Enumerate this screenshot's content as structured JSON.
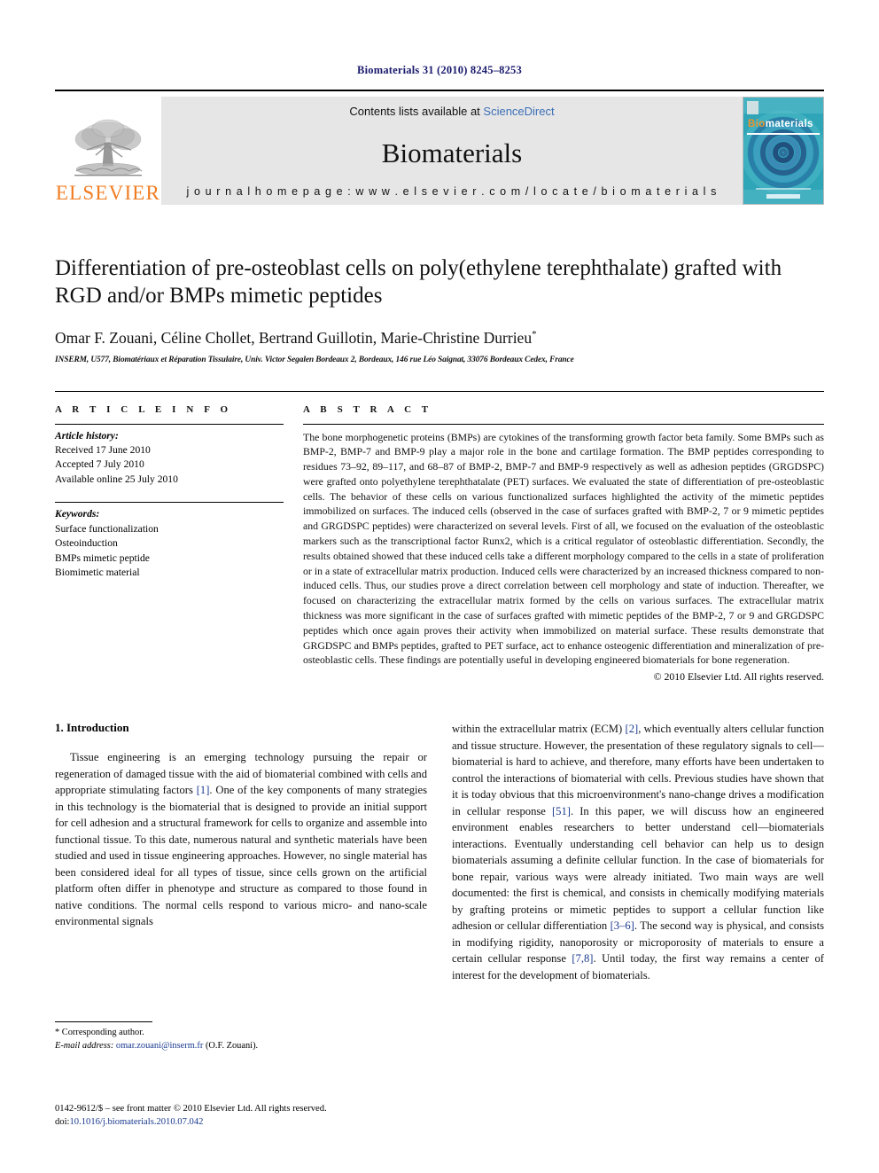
{
  "running_head": "Biomaterials 31 (2010) 8245–8253",
  "header": {
    "publisher_name": "ELSEVIER",
    "contents_prefix": "Contents lists available at ",
    "contents_link": "ScienceDirect",
    "journal_name": "Biomaterials",
    "homepage": "j o u r n a l   h o m e p a g e :   w w w . e l s e v i e r . c o m / l o c a t e / b i o m a t e r i a l s",
    "cover": {
      "title_bio": "Bio",
      "title_materials": "materials",
      "accent_color": "#f0922a",
      "background_color": "#2fa5b8"
    }
  },
  "article": {
    "title": "Differentiation of pre-osteoblast cells on poly(ethylene terephthalate) grafted with RGD and/or BMPs mimetic peptides",
    "authors": "Omar F. Zouani, Céline Chollet, Bertrand Guillotin, Marie-Christine Durrieu",
    "author_mark": "*",
    "affiliation": "INSERM, U577, Biomatériaux et Réparation Tissulaire, Univ. Victor Segalen Bordeaux 2, Bordeaux, 146 rue Léo Saignat, 33076 Bordeaux Cedex, France"
  },
  "article_info": {
    "heading": "A R T I C L E   I N F O",
    "history_label": "Article history:",
    "history": [
      "Received 17 June 2010",
      "Accepted 7 July 2010",
      "Available online 25 July 2010"
    ],
    "keywords_label": "Keywords:",
    "keywords": [
      "Surface functionalization",
      "Osteoinduction",
      "BMPs mimetic peptide",
      "Biomimetic material"
    ]
  },
  "abstract": {
    "heading": "A B S T R A C T",
    "text": "The bone morphogenetic proteins (BMPs) are cytokines of the transforming growth factor beta family. Some BMPs such as BMP-2, BMP-7 and BMP-9 play a major role in the bone and cartilage formation. The BMP peptides corresponding to residues 73–92, 89–117, and 68–87 of BMP-2, BMP-7 and BMP-9 respectively as well as adhesion peptides (GRGDSPC) were grafted onto polyethylene terephthatalate (PET) surfaces. We evaluated the state of differentiation of pre-osteoblastic cells. The behavior of these cells on various functionalized surfaces highlighted the activity of the mimetic peptides immobilized on surfaces. The induced cells (observed in the case of surfaces grafted with BMP-2, 7 or 9 mimetic peptides and GRGDSPC peptides) were characterized on several levels. First of all, we focused on the evaluation of the osteoblastic markers such as the transcriptional factor Runx2, which is a critical regulator of osteoblastic differentiation. Secondly, the results obtained showed that these induced cells take a different morphology compared to the cells in a state of proliferation or in a state of extracellular matrix production. Induced cells were characterized by an increased thickness compared to non-induced cells. Thus, our studies prove a direct correlation between cell morphology and state of induction. Thereafter, we focused on characterizing the extracellular matrix formed by the cells on various surfaces. The extracellular matrix thickness was more significant in the case of surfaces grafted with mimetic peptides of the BMP-2, 7 or 9 and GRGDSPC peptides which once again proves their activity when immobilized on material surface. These results demonstrate that GRGDSPC and BMPs peptides, grafted to PET surface, act to enhance osteogenic differentiation and mineralization of pre-osteoblastic cells. These findings are potentially useful in developing engineered biomaterials for bone regeneration.",
    "copyright": "© 2010 Elsevier Ltd. All rights reserved."
  },
  "introduction": {
    "heading": "1. Introduction",
    "left_column_html": "Tissue engineering is an emerging technology pursuing the repair or regeneration of damaged tissue with the aid of biomaterial combined with cells and appropriate stimulating factors <span class=\"ref\">[1]</span>. One of the key components of many strategies in this technology is the biomaterial that is designed to provide an initial support for cell adhesion and a structural framework for cells to organize and assemble into functional tissue. To this date, numerous natural and synthetic materials have been studied and used in tissue engineering approaches. However, no single material has been considered ideal for all types of tissue, since cells grown on the artificial platform often differ in phenotype and structure as compared to those found in native conditions. The normal cells respond to various micro- and nano-scale environmental signals",
    "right_column_html": "within the extracellular matrix (ECM) <span class=\"ref\">[2]</span>, which eventually alters cellular function and tissue structure. However, the presentation of these regulatory signals to cell—biomaterial is hard to achieve, and therefore, many efforts have been undertaken to control the interactions of biomaterial with cells. Previous studies have shown that it is today obvious that this microenvironment's nano-change drives a modification in cellular response <span class=\"ref\">[51]</span>. In this paper, we will discuss how an engineered environment enables researchers to better understand cell—biomaterials interactions. Eventually understanding cell behavior can help us to design biomaterials assuming a definite cellular function. In the case of biomaterials for bone repair, various ways were already initiated. Two main ways are well documented: the first is chemical, and consists in chemically modifying materials by grafting proteins or mimetic peptides to support a cellular function like adhesion or cellular differentiation <span class=\"ref\">[3–6]</span>. The second way is physical, and consists in modifying rigidity, nanoporosity or microporosity of materials to ensure a certain cellular response <span class=\"ref\">[7,8]</span>. Until today, the first way remains a center of interest for the development of biomaterials."
  },
  "footnote": {
    "corresponding": "* Corresponding author.",
    "email_label": "E-mail address:",
    "email": "omar.zouani@inserm.fr",
    "email_owner": "(O.F. Zouani)."
  },
  "footer": {
    "issn_line": "0142-9612/$ – see front matter © 2010 Elsevier Ltd. All rights reserved.",
    "doi_label": "doi:",
    "doi": "10.1016/j.biomaterials.2010.07.042"
  }
}
